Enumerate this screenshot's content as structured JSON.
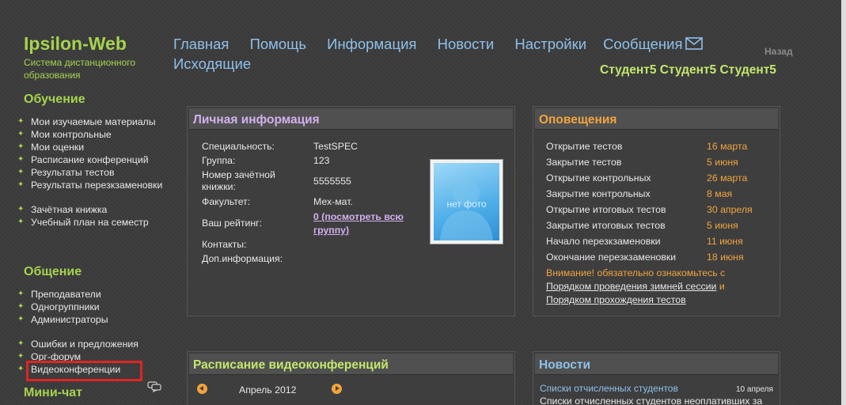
{
  "header": {
    "logo": "Ipsilon-Web",
    "tagline": "Система дистанционного образования",
    "back": "Назад",
    "username": "Студент5 Студент5 Студент5"
  },
  "nav": {
    "items": [
      "Главная",
      "Помощь",
      "Информация",
      "Новости",
      "Настройки",
      "Сообщения",
      "Исходящие"
    ]
  },
  "sidebar": {
    "learning_heading": "Обучение",
    "learning_items": [
      "Мои изучаемые материалы",
      "Мои контрольные",
      "Мои оценки",
      "Расписание конференций",
      "Результаты тестов",
      "Результаты перезкзаменовки",
      "Зачётная книжка",
      "Учебный план на семестр"
    ],
    "communication_heading": "Общение",
    "communication_items": [
      "Преподаватели",
      "Одногруппники",
      "Администраторы",
      "Ошибки и предложения",
      "Орг-форум",
      "Видеоконференции"
    ],
    "minichat_heading": "Мини-чат"
  },
  "personal": {
    "title": "Личная информация",
    "specialty_label": "Специальность:",
    "specialty_value": "TestSPEC",
    "group_label": "Группа:",
    "group_value": "123",
    "record_label": "Номер зачётной книжки:",
    "record_value": "5555555",
    "faculty_label": "Факультет:",
    "faculty_value": "Мех-мат.",
    "rating_label": "Ваш рейтинг:",
    "rating_value": "0 (посмотреть всю группу)",
    "contacts_label": "Контакты:",
    "extra_label": "Доп.информация:",
    "photo_placeholder": "нет фото"
  },
  "notifications": {
    "title": "Оповещения",
    "items": [
      {
        "label": "Открытие тестов",
        "date": "16 марта"
      },
      {
        "label": "Закрытие тестов",
        "date": "5 июня"
      },
      {
        "label": "Открытие контрольных",
        "date": "26 марта"
      },
      {
        "label": "Закрытие контрольных",
        "date": "8 мая"
      },
      {
        "label": "Открытие итоговых тестов",
        "date": "30 апреля"
      },
      {
        "label": "Закрытие итоговых тестов",
        "date": "5 июня"
      },
      {
        "label": "Начало перезкзаменовки",
        "date": "11 июня"
      },
      {
        "label": "Окончание перезкзаменовки",
        "date": "18 июня"
      }
    ],
    "warning_text": "Внимание! обязательно ознакомьтесь с",
    "warning_link1": "Порядком проведения зимней сессии",
    "warning_and": "и",
    "warning_link2": "Порядком прохождения тестов"
  },
  "schedule": {
    "title": "Расписание видеоконференций",
    "month": "Апрель 2012"
  },
  "news": {
    "title": "Новости",
    "item_title": "Списки отчисленных студентов",
    "item_date": "10 апреля",
    "item_text": "Списки отчисленных студентов неоплативших за"
  },
  "colors": {
    "accent_green": "#a6d34e",
    "link_blue": "#8fc0ea",
    "date_orange": "#f0a540",
    "personal_title": "#d3b0ee",
    "highlight_red": "#e02424"
  }
}
